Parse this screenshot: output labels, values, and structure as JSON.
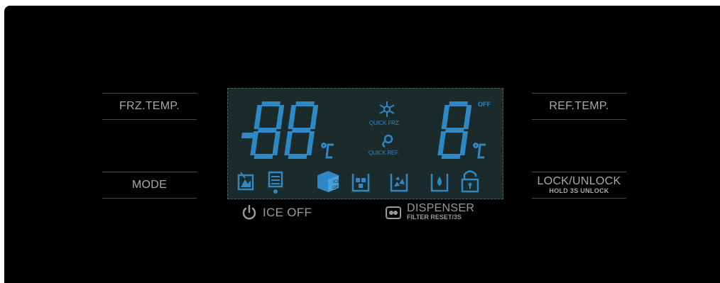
{
  "left_buttons": {
    "frz_temp": "FRZ.TEMP.",
    "mode": "MODE"
  },
  "right_buttons": {
    "ref_temp": "REF.TEMP.",
    "lock_unlock": "LOCK/UNLOCK",
    "lock_unlock_sub": "HOLD 3S UNLOCK"
  },
  "display": {
    "freezer_temp": "-88",
    "freezer_unit": "°C",
    "fridge_temp": "8",
    "fridge_unit": "°C",
    "fridge_off_indicator": "OFF",
    "quick_frz_label": "QUICK FRZ.",
    "quick_ref_label": "QUICK REF.",
    "ice_off_icon_text": "ICE\nOFF",
    "status_icons": [
      "ice-tray-icon",
      "water-filter-icon",
      "ice-off-cube-icon",
      "cubed-ice-icon",
      "crushed-ice-icon",
      "water-icon",
      "lock-icon"
    ],
    "segment_color": "#2f87c4"
  },
  "bottom_buttons": {
    "ice_off": "ICE OFF",
    "dispenser": "DISPENSER",
    "dispenser_sub": "FILTER RESET/3S"
  }
}
